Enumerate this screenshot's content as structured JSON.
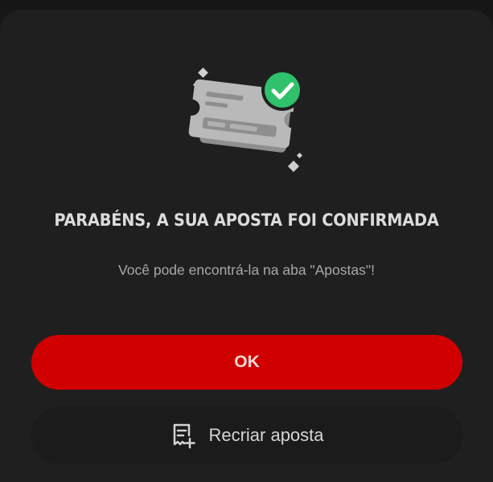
{
  "dialog": {
    "title": "PARABÉNS, A SUA APOSTA FOI CONFIRMADA",
    "subtitle": "Você pode encontrá-la na aba \"Apostas\"!",
    "ok_label": "OK",
    "recreate_label": "Recriar aposta"
  },
  "icons": {
    "illustration": "confirmed-ticket-icon",
    "recreate": "receipt-add-icon"
  },
  "colors": {
    "primary_button": "#d10000",
    "check_badge": "#2fc16b",
    "background": "#1f1f1f"
  }
}
